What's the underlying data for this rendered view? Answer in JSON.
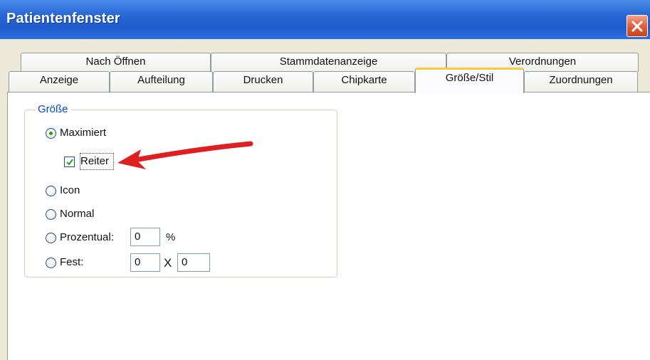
{
  "window": {
    "title": "Patientenfenster",
    "close_icon": "close-icon"
  },
  "tabs_row1": [
    {
      "label": "Nach Öffnen"
    },
    {
      "label": "Stammdatenanzeige"
    },
    {
      "label": "Verordnungen"
    }
  ],
  "tabs_row2": [
    {
      "label": "Anzeige"
    },
    {
      "label": "Aufteilung"
    },
    {
      "label": "Drucken"
    },
    {
      "label": "Chipkarte"
    },
    {
      "label": "Größe/Stil",
      "active": true
    },
    {
      "label": "Zuordnungen"
    }
  ],
  "groupbox": {
    "label": "Größe",
    "options": {
      "maximiert": {
        "label": "Maximiert",
        "selected": true
      },
      "reiter": {
        "label": "Reiter",
        "checked": true
      },
      "icon": {
        "label": "Icon",
        "selected": false
      },
      "normal": {
        "label": "Normal",
        "selected": false
      },
      "prozentual": {
        "label": "Prozentual:",
        "selected": false,
        "value": "0",
        "unit": "%"
      },
      "fest": {
        "label": "Fest:",
        "selected": false,
        "width": "0",
        "separator": "X",
        "height": "0"
      }
    }
  },
  "annotation": {
    "arrow_color": "#e02020",
    "icon": "red-arrow"
  }
}
